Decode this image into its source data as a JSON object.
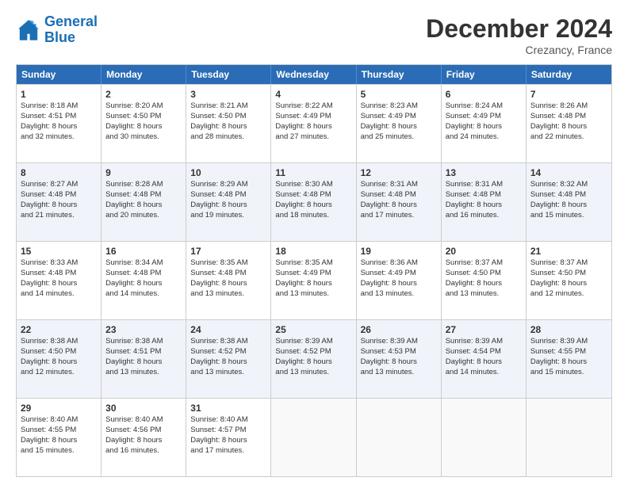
{
  "logo": {
    "line1": "General",
    "line2": "Blue"
  },
  "title": "December 2024",
  "subtitle": "Crezancy, France",
  "headers": [
    "Sunday",
    "Monday",
    "Tuesday",
    "Wednesday",
    "Thursday",
    "Friday",
    "Saturday"
  ],
  "rows": [
    [
      {
        "day": "1",
        "lines": [
          "Sunrise: 8:18 AM",
          "Sunset: 4:51 PM",
          "Daylight: 8 hours",
          "and 32 minutes."
        ]
      },
      {
        "day": "2",
        "lines": [
          "Sunrise: 8:20 AM",
          "Sunset: 4:50 PM",
          "Daylight: 8 hours",
          "and 30 minutes."
        ]
      },
      {
        "day": "3",
        "lines": [
          "Sunrise: 8:21 AM",
          "Sunset: 4:50 PM",
          "Daylight: 8 hours",
          "and 28 minutes."
        ]
      },
      {
        "day": "4",
        "lines": [
          "Sunrise: 8:22 AM",
          "Sunset: 4:49 PM",
          "Daylight: 8 hours",
          "and 27 minutes."
        ]
      },
      {
        "day": "5",
        "lines": [
          "Sunrise: 8:23 AM",
          "Sunset: 4:49 PM",
          "Daylight: 8 hours",
          "and 25 minutes."
        ]
      },
      {
        "day": "6",
        "lines": [
          "Sunrise: 8:24 AM",
          "Sunset: 4:49 PM",
          "Daylight: 8 hours",
          "and 24 minutes."
        ]
      },
      {
        "day": "7",
        "lines": [
          "Sunrise: 8:26 AM",
          "Sunset: 4:48 PM",
          "Daylight: 8 hours",
          "and 22 minutes."
        ]
      }
    ],
    [
      {
        "day": "8",
        "lines": [
          "Sunrise: 8:27 AM",
          "Sunset: 4:48 PM",
          "Daylight: 8 hours",
          "and 21 minutes."
        ]
      },
      {
        "day": "9",
        "lines": [
          "Sunrise: 8:28 AM",
          "Sunset: 4:48 PM",
          "Daylight: 8 hours",
          "and 20 minutes."
        ]
      },
      {
        "day": "10",
        "lines": [
          "Sunrise: 8:29 AM",
          "Sunset: 4:48 PM",
          "Daylight: 8 hours",
          "and 19 minutes."
        ]
      },
      {
        "day": "11",
        "lines": [
          "Sunrise: 8:30 AM",
          "Sunset: 4:48 PM",
          "Daylight: 8 hours",
          "and 18 minutes."
        ]
      },
      {
        "day": "12",
        "lines": [
          "Sunrise: 8:31 AM",
          "Sunset: 4:48 PM",
          "Daylight: 8 hours",
          "and 17 minutes."
        ]
      },
      {
        "day": "13",
        "lines": [
          "Sunrise: 8:31 AM",
          "Sunset: 4:48 PM",
          "Daylight: 8 hours",
          "and 16 minutes."
        ]
      },
      {
        "day": "14",
        "lines": [
          "Sunrise: 8:32 AM",
          "Sunset: 4:48 PM",
          "Daylight: 8 hours",
          "and 15 minutes."
        ]
      }
    ],
    [
      {
        "day": "15",
        "lines": [
          "Sunrise: 8:33 AM",
          "Sunset: 4:48 PM",
          "Daylight: 8 hours",
          "and 14 minutes."
        ]
      },
      {
        "day": "16",
        "lines": [
          "Sunrise: 8:34 AM",
          "Sunset: 4:48 PM",
          "Daylight: 8 hours",
          "and 14 minutes."
        ]
      },
      {
        "day": "17",
        "lines": [
          "Sunrise: 8:35 AM",
          "Sunset: 4:48 PM",
          "Daylight: 8 hours",
          "and 13 minutes."
        ]
      },
      {
        "day": "18",
        "lines": [
          "Sunrise: 8:35 AM",
          "Sunset: 4:49 PM",
          "Daylight: 8 hours",
          "and 13 minutes."
        ]
      },
      {
        "day": "19",
        "lines": [
          "Sunrise: 8:36 AM",
          "Sunset: 4:49 PM",
          "Daylight: 8 hours",
          "and 13 minutes."
        ]
      },
      {
        "day": "20",
        "lines": [
          "Sunrise: 8:37 AM",
          "Sunset: 4:50 PM",
          "Daylight: 8 hours",
          "and 13 minutes."
        ]
      },
      {
        "day": "21",
        "lines": [
          "Sunrise: 8:37 AM",
          "Sunset: 4:50 PM",
          "Daylight: 8 hours",
          "and 12 minutes."
        ]
      }
    ],
    [
      {
        "day": "22",
        "lines": [
          "Sunrise: 8:38 AM",
          "Sunset: 4:50 PM",
          "Daylight: 8 hours",
          "and 12 minutes."
        ]
      },
      {
        "day": "23",
        "lines": [
          "Sunrise: 8:38 AM",
          "Sunset: 4:51 PM",
          "Daylight: 8 hours",
          "and 13 minutes."
        ]
      },
      {
        "day": "24",
        "lines": [
          "Sunrise: 8:38 AM",
          "Sunset: 4:52 PM",
          "Daylight: 8 hours",
          "and 13 minutes."
        ]
      },
      {
        "day": "25",
        "lines": [
          "Sunrise: 8:39 AM",
          "Sunset: 4:52 PM",
          "Daylight: 8 hours",
          "and 13 minutes."
        ]
      },
      {
        "day": "26",
        "lines": [
          "Sunrise: 8:39 AM",
          "Sunset: 4:53 PM",
          "Daylight: 8 hours",
          "and 13 minutes."
        ]
      },
      {
        "day": "27",
        "lines": [
          "Sunrise: 8:39 AM",
          "Sunset: 4:54 PM",
          "Daylight: 8 hours",
          "and 14 minutes."
        ]
      },
      {
        "day": "28",
        "lines": [
          "Sunrise: 8:39 AM",
          "Sunset: 4:55 PM",
          "Daylight: 8 hours",
          "and 15 minutes."
        ]
      }
    ],
    [
      {
        "day": "29",
        "lines": [
          "Sunrise: 8:40 AM",
          "Sunset: 4:55 PM",
          "Daylight: 8 hours",
          "and 15 minutes."
        ]
      },
      {
        "day": "30",
        "lines": [
          "Sunrise: 8:40 AM",
          "Sunset: 4:56 PM",
          "Daylight: 8 hours",
          "and 16 minutes."
        ]
      },
      {
        "day": "31",
        "lines": [
          "Sunrise: 8:40 AM",
          "Sunset: 4:57 PM",
          "Daylight: 8 hours",
          "and 17 minutes."
        ]
      },
      null,
      null,
      null,
      null
    ]
  ]
}
